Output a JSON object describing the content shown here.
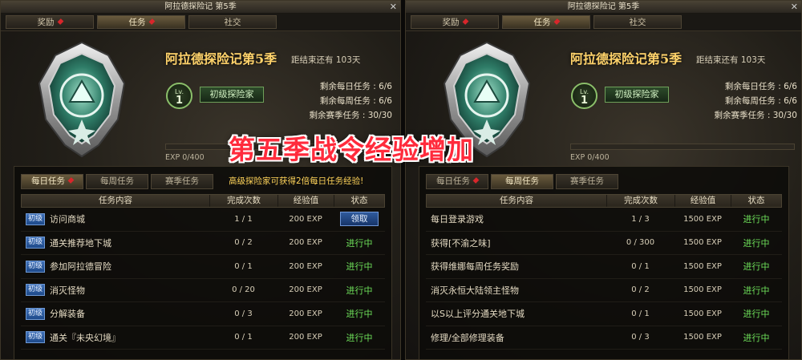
{
  "overlay_caption": "第五季战令经验增加",
  "panels": [
    {
      "window_title": "阿拉德探险记 第5季",
      "nav": [
        {
          "label": "奖励",
          "alert": true
        },
        {
          "label": "任务",
          "alert": true,
          "active": true
        },
        {
          "label": "社交"
        }
      ],
      "season_title": "阿拉德探险记第5季",
      "remaining_time": "距结束还有 103天",
      "level": {
        "prefix": "Lv.",
        "value": "1"
      },
      "rank_label": "初级探险家",
      "counts": [
        "剩余每日任务 : 6/6",
        "剩余每周任务 : 6/6",
        "剩余赛季任务 : 30/30"
      ],
      "exp_text": "EXP  0/400",
      "exp_progress": 0,
      "subtabs": [
        {
          "label": "每日任务",
          "alert": true,
          "active": true
        },
        {
          "label": "每周任务"
        },
        {
          "label": "赛季任务"
        }
      ],
      "notice": "高级探险家可获得2倍每日任务经验!",
      "headers": [
        "任务内容",
        "完成次数",
        "经验值",
        "状态"
      ],
      "rows": [
        {
          "tag": "初级",
          "name": "访问商城",
          "count": "1 / 1",
          "exp": "200 EXP",
          "status": "领取",
          "claim": true
        },
        {
          "tag": "初级",
          "name": "通关推荐地下城",
          "count": "0 / 2",
          "exp": "200 EXP",
          "status": "进行中"
        },
        {
          "tag": "初级",
          "name": "参加阿拉德冒险",
          "count": "0 / 1",
          "exp": "200 EXP",
          "status": "进行中"
        },
        {
          "tag": "初级",
          "name": "消灭怪物",
          "count": "0 / 20",
          "exp": "200 EXP",
          "status": "进行中"
        },
        {
          "tag": "初级",
          "name": "分解装备",
          "count": "0 / 3",
          "exp": "200 EXP",
          "status": "进行中"
        },
        {
          "tag": "初级",
          "name": "通关『未央幻境』",
          "count": "0 / 1",
          "exp": "200 EXP",
          "status": "进行中"
        }
      ]
    },
    {
      "window_title": "阿拉德探险记 第5季",
      "nav": [
        {
          "label": "奖励",
          "alert": true
        },
        {
          "label": "任务",
          "alert": true,
          "active": true
        },
        {
          "label": "社交"
        }
      ],
      "season_title": "阿拉德探险记第5季",
      "remaining_time": "距结束还有 103天",
      "level": {
        "prefix": "Lv.",
        "value": "1"
      },
      "rank_label": "初级探险家",
      "counts": [
        "剩余每日任务 : 6/6",
        "剩余每周任务 : 6/6",
        "剩余赛季任务 : 30/30"
      ],
      "exp_text": "EXP  0/400",
      "exp_progress": 0,
      "subtabs": [
        {
          "label": "每日任务",
          "alert": true
        },
        {
          "label": "每周任务",
          "active": true
        },
        {
          "label": "赛季任务"
        }
      ],
      "notice": "",
      "headers": [
        "任务内容",
        "完成次数",
        "经验值",
        "状态"
      ],
      "rows": [
        {
          "name": "每日登录游戏",
          "count": "1 / 3",
          "exp": "1500 EXP",
          "status": "进行中"
        },
        {
          "name": "获得[不渝之味]",
          "count": "0 / 300",
          "exp": "1500 EXP",
          "status": "进行中"
        },
        {
          "name": "获得维娜每周任务奖励",
          "count": "0 / 1",
          "exp": "1500 EXP",
          "status": "进行中"
        },
        {
          "name": "消灭永恒大陆领主怪物",
          "count": "0 / 2",
          "exp": "1500 EXP",
          "status": "进行中"
        },
        {
          "name": "以S以上评分通关地下城",
          "count": "0 / 1",
          "exp": "1500 EXP",
          "status": "进行中"
        },
        {
          "name": "修理/全部修理装备",
          "count": "0 / 3",
          "exp": "1500 EXP",
          "status": "进行中"
        }
      ]
    }
  ]
}
